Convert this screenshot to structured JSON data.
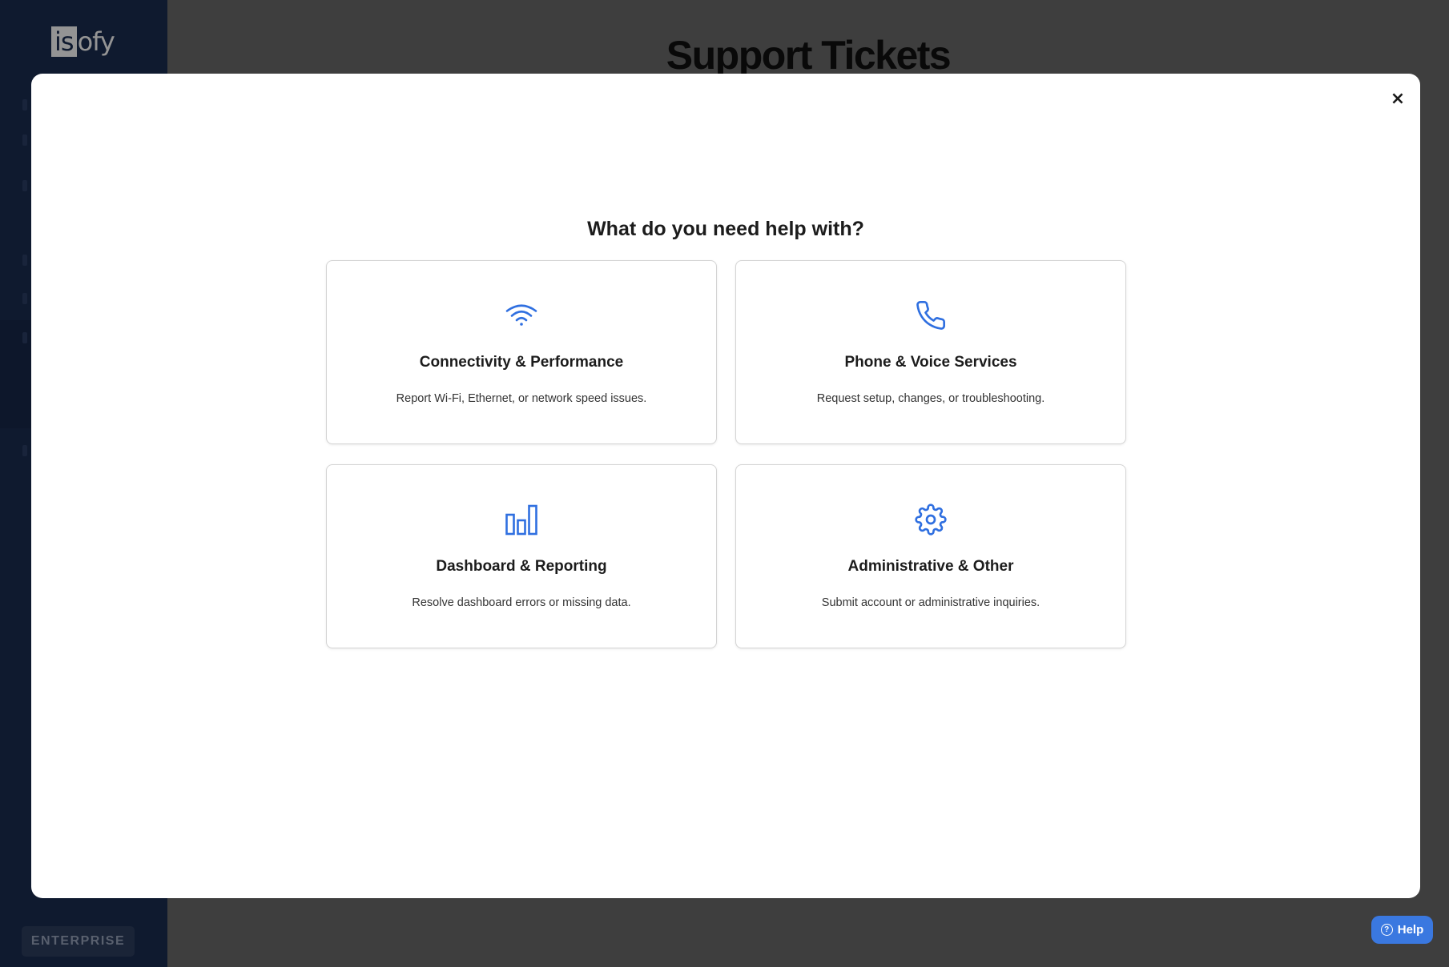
{
  "app": {
    "logo_prefix": "is",
    "logo_suffix": "ofy",
    "plan_badge": "ENTERPRISE"
  },
  "page": {
    "title": "Support Tickets"
  },
  "help_button": {
    "label": "Help",
    "glyph": "?"
  },
  "modal": {
    "close_glyph": "×",
    "heading": "What do you need help with?",
    "cards": [
      {
        "icon": "wifi-icon",
        "title": "Connectivity & Performance",
        "description": "Report Wi-Fi, Ethernet, or network speed issues."
      },
      {
        "icon": "phone-icon",
        "title": "Phone & Voice Services",
        "description": "Request setup, changes, or troubleshooting."
      },
      {
        "icon": "bar-chart-icon",
        "title": "Dashboard & Reporting",
        "description": "Resolve dashboard errors or missing data."
      },
      {
        "icon": "gear-icon",
        "title": "Administrative & Other",
        "description": "Submit account or administrative inquiries."
      }
    ]
  },
  "colors": {
    "accent": "#2f6fe0",
    "sidebar": "#1b2e52",
    "help_button": "#3a78e0"
  }
}
